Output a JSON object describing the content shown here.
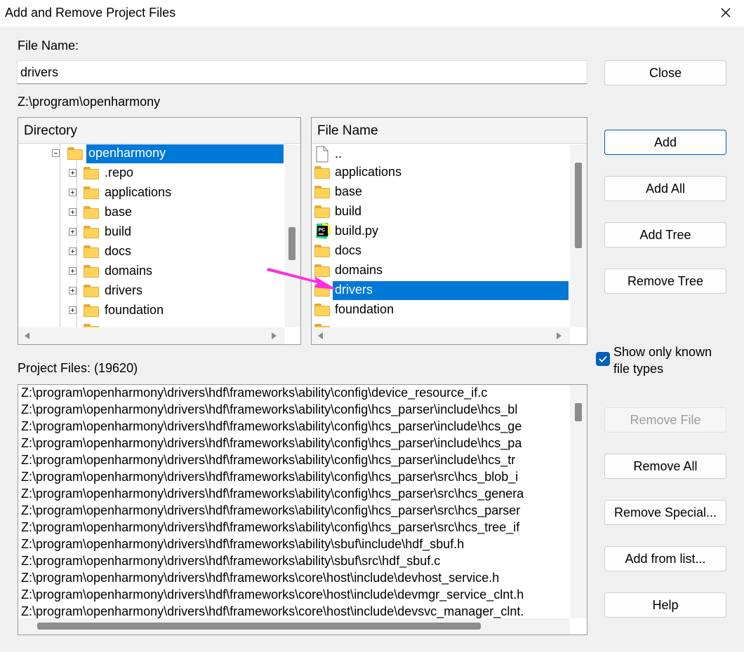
{
  "window": {
    "title": "Add and Remove Project Files",
    "close_icon": "close-icon"
  },
  "file_name": {
    "label": "File Name:",
    "value": "drivers"
  },
  "current_path": "Z:\\program\\openharmony",
  "directory_panel": {
    "header": "Directory",
    "items": [
      {
        "label": "openharmony",
        "expanded": true,
        "selected": true
      },
      {
        "label": ".repo"
      },
      {
        "label": "applications"
      },
      {
        "label": "base"
      },
      {
        "label": "build"
      },
      {
        "label": "docs"
      },
      {
        "label": "domains"
      },
      {
        "label": "drivers"
      },
      {
        "label": "foundation"
      }
    ]
  },
  "file_panel": {
    "header": "File Name",
    "items": [
      {
        "label": "..",
        "type": "file"
      },
      {
        "label": "applications",
        "type": "folder"
      },
      {
        "label": "base",
        "type": "folder"
      },
      {
        "label": "build",
        "type": "folder"
      },
      {
        "label": "build.py",
        "type": "pycharm"
      },
      {
        "label": "docs",
        "type": "folder"
      },
      {
        "label": "domains",
        "type": "folder"
      },
      {
        "label": "drivers",
        "type": "folder",
        "selected": true
      },
      {
        "label": "foundation",
        "type": "folder"
      }
    ]
  },
  "project_files": {
    "label": "Project Files: (19620)",
    "lines": [
      "Z:\\program\\openharmony\\drivers\\hdf\\frameworks\\ability\\config\\device_resource_if.c",
      "Z:\\program\\openharmony\\drivers\\hdf\\frameworks\\ability\\config\\hcs_parser\\include\\hcs_bl",
      "Z:\\program\\openharmony\\drivers\\hdf\\frameworks\\ability\\config\\hcs_parser\\include\\hcs_ge",
      "Z:\\program\\openharmony\\drivers\\hdf\\frameworks\\ability\\config\\hcs_parser\\include\\hcs_pa",
      "Z:\\program\\openharmony\\drivers\\hdf\\frameworks\\ability\\config\\hcs_parser\\include\\hcs_tr",
      "Z:\\program\\openharmony\\drivers\\hdf\\frameworks\\ability\\config\\hcs_parser\\src\\hcs_blob_i",
      "Z:\\program\\openharmony\\drivers\\hdf\\frameworks\\ability\\config\\hcs_parser\\src\\hcs_genera",
      "Z:\\program\\openharmony\\drivers\\hdf\\frameworks\\ability\\config\\hcs_parser\\src\\hcs_parser",
      "Z:\\program\\openharmony\\drivers\\hdf\\frameworks\\ability\\config\\hcs_parser\\src\\hcs_tree_if",
      "Z:\\program\\openharmony\\drivers\\hdf\\frameworks\\ability\\sbuf\\include\\hdf_sbuf.h",
      "Z:\\program\\openharmony\\drivers\\hdf\\frameworks\\ability\\sbuf\\src\\hdf_sbuf.c",
      "Z:\\program\\openharmony\\drivers\\hdf\\frameworks\\core\\host\\include\\devhost_service.h",
      "Z:\\program\\openharmony\\drivers\\hdf\\frameworks\\core\\host\\include\\devmgr_service_clnt.h",
      "Z:\\program\\openharmony\\drivers\\hdf\\frameworks\\core\\host\\include\\devsvc_manager_clnt."
    ]
  },
  "buttons": {
    "close": "Close",
    "add": "Add",
    "add_all": "Add All",
    "add_tree": "Add Tree",
    "remove_tree": "Remove Tree",
    "remove_file": "Remove File",
    "remove_all": "Remove All",
    "remove_special": "Remove Special...",
    "add_from_list": "Add from list...",
    "help": "Help"
  },
  "show_known": {
    "label_line1": "Show only known",
    "label_line2": "file types",
    "checked": true
  },
  "colors": {
    "selection": "#0078d7",
    "accent": "#005fb8",
    "annotation_arrow": "#ff2de0"
  }
}
